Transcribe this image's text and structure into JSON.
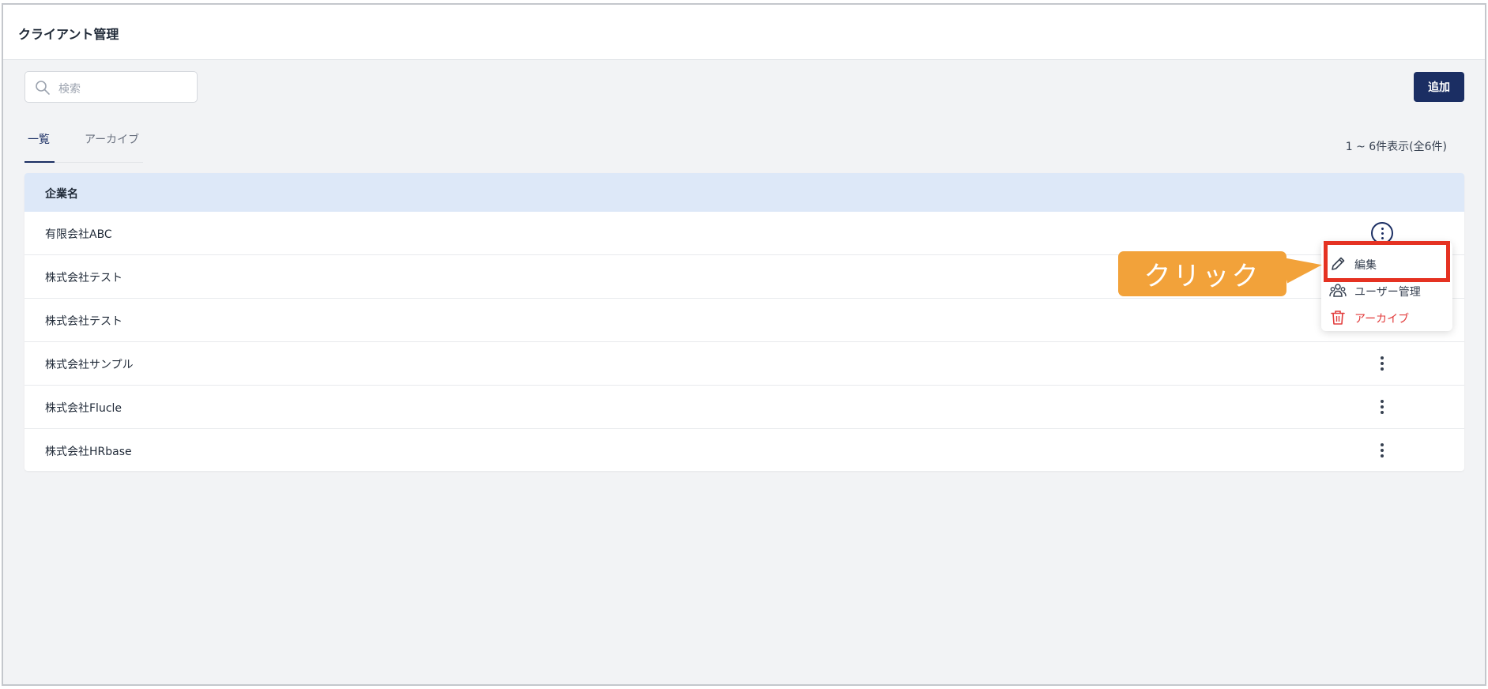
{
  "page": {
    "title": "クライアント管理"
  },
  "search": {
    "placeholder": "検索"
  },
  "toolbar": {
    "add_label": "追加"
  },
  "tabs": [
    {
      "label": "一覧",
      "active": true
    },
    {
      "label": "アーカイブ",
      "active": false
    }
  ],
  "pagination": {
    "summary": "1 ~ 6件表示(全6件)"
  },
  "table": {
    "header": "企業名",
    "rows": [
      {
        "name": "有限会社ABC"
      },
      {
        "name": "株式会社テスト"
      },
      {
        "name": "株式会社テスト"
      },
      {
        "name": "株式会社サンプル"
      },
      {
        "name": "株式会社Flucle"
      },
      {
        "name": "株式会社HRbase"
      }
    ]
  },
  "row_menu": {
    "items": [
      {
        "label": "編集",
        "icon": "pencil-icon"
      },
      {
        "label": "ユーザー管理",
        "icon": "users-icon"
      },
      {
        "label": "アーカイブ",
        "icon": "trash-icon",
        "color": "#e23b3b"
      }
    ]
  },
  "annotation": {
    "callout_text": "クリック",
    "callout_color": "#f2a23a",
    "highlight_color": "#e53222"
  },
  "colors": {
    "primary": "#1b2e63",
    "table_header_bg": "#dde8f8",
    "page_bg": "#f2f3f5"
  }
}
